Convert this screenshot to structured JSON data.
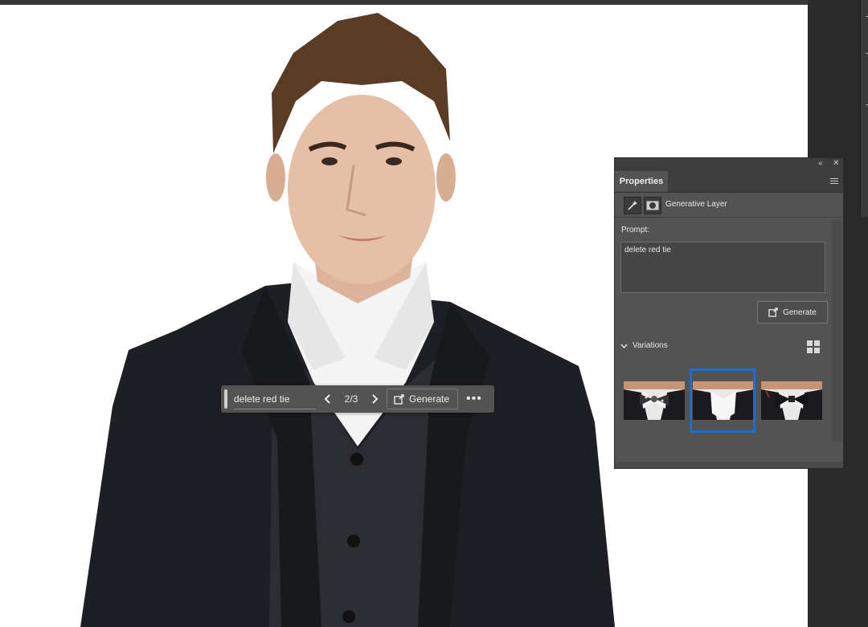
{
  "contextual_taskbar": {
    "prompt_value": "delete red tie",
    "counter": "2/3",
    "generate_label": "Generate",
    "more_icon": "ellipsis-icon"
  },
  "properties_panel": {
    "tab_label": "Properties",
    "layer_type_label": "Generative Layer",
    "prompt_label": "Prompt:",
    "prompt_value": "delete red tie",
    "generate_label": "Generate",
    "variations_label": "Variations",
    "selected_variation": 2,
    "accent_color": "#1a6fd6"
  },
  "canvas": {
    "background": "#ffffff"
  }
}
